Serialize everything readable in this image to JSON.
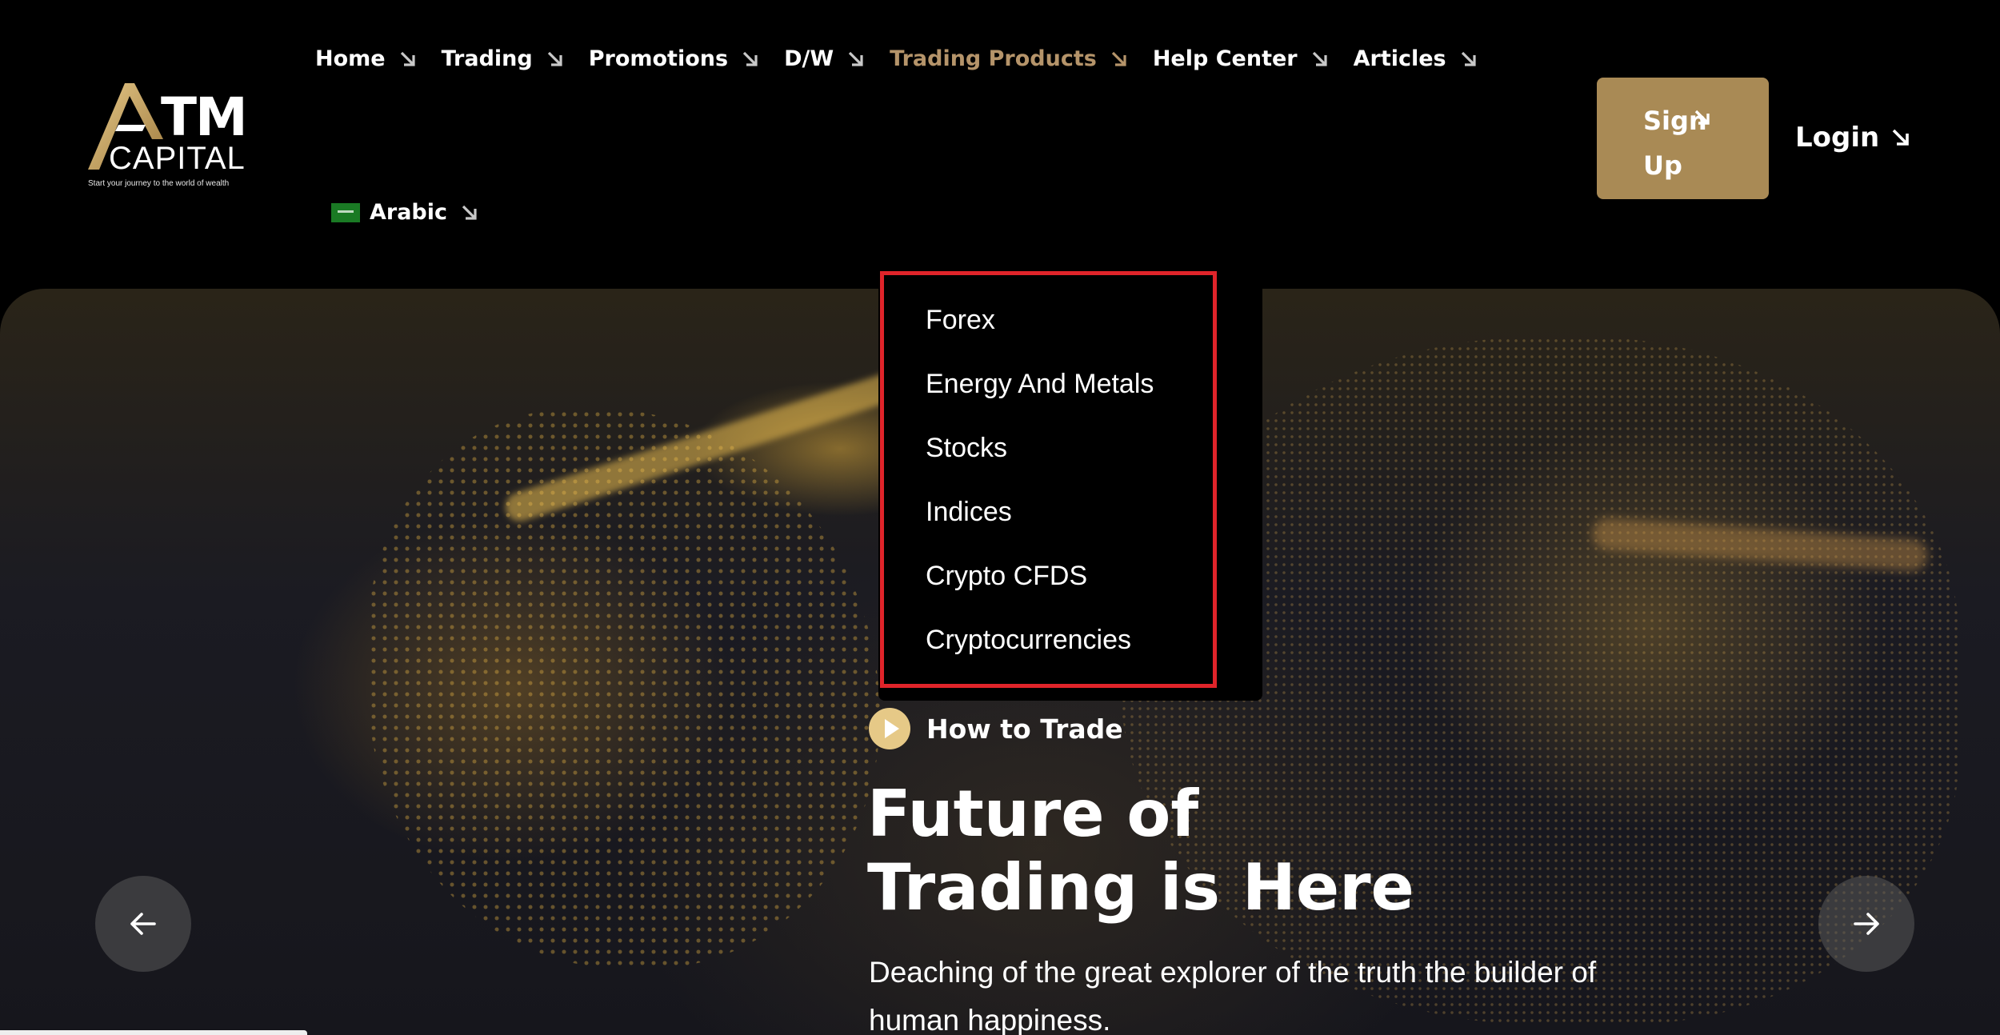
{
  "logo": {
    "brand_top": "TM",
    "brand_bottom": "CAPITAL",
    "tagline": "Start your journey to the world of wealth"
  },
  "nav": {
    "items": [
      {
        "label": "Home"
      },
      {
        "label": "Trading"
      },
      {
        "label": "Promotions"
      },
      {
        "label": "D/W"
      },
      {
        "label": "Trading Products",
        "active": true
      },
      {
        "label": "Help Center"
      },
      {
        "label": "Articles"
      }
    ],
    "language": "Arabic"
  },
  "auth": {
    "signup_line1": "Sign",
    "signup_line2": "Up",
    "login": "Login"
  },
  "dropdown": {
    "items": [
      "Forex",
      "Energy And Metals",
      "Stocks",
      "Indices",
      "Crypto CFDS",
      "Cryptocurrencies"
    ]
  },
  "hero": {
    "how_to": "How to Trade",
    "title_line1": "Future of",
    "title_line2": "Trading is Here",
    "subtitle": "Deaching of the great explorer of the truth the builder of human happiness."
  },
  "colors": {
    "accent": "#a98a55",
    "nav_active": "#b5946a",
    "highlight_border": "#e0242a",
    "play_button": "#e6c987"
  }
}
